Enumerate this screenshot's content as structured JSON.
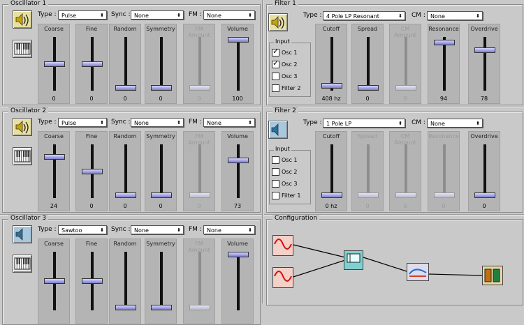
{
  "oscillators": [
    {
      "title": "Oscillator 1",
      "type": "Pulse",
      "sync": "None",
      "fm": "None",
      "icon": "speaker-on-icon",
      "sliders": [
        {
          "name": "Coarse",
          "value": "0",
          "level": 0.5,
          "dim": false
        },
        {
          "name": "Fine",
          "value": "0",
          "level": 0.5,
          "dim": false
        },
        {
          "name": "Random",
          "value": "0",
          "level": 0,
          "dim": false
        },
        {
          "name": "Symmetry",
          "value": "0",
          "level": 0,
          "dim": false
        },
        {
          "name": "FM Amount",
          "value": "0",
          "level": 0,
          "dim": true
        },
        {
          "name": "Volume",
          "value": "100",
          "level": 1,
          "dim": false
        }
      ]
    },
    {
      "title": "Oscillator 2",
      "type": "Pulse",
      "sync": "None",
      "fm": "None",
      "icon": "speaker-on-icon",
      "sliders": [
        {
          "name": "Coarse",
          "value": "24",
          "level": 0.8,
          "dim": false
        },
        {
          "name": "Fine",
          "value": "0",
          "level": 0.5,
          "dim": false
        },
        {
          "name": "Random",
          "value": "0",
          "level": 0,
          "dim": false
        },
        {
          "name": "Symmetry",
          "value": "0",
          "level": 0,
          "dim": false
        },
        {
          "name": "FM Amount",
          "value": "0",
          "level": 0,
          "dim": true
        },
        {
          "name": "Volume",
          "value": "73",
          "level": 0.73,
          "dim": false
        }
      ]
    },
    {
      "title": "Oscillator 3",
      "type": "Sawtoo",
      "sync": "None",
      "fm": "None",
      "icon": "speaker-off-icon",
      "sliders": [
        {
          "name": "Coarse",
          "value": "",
          "level": 0.5,
          "dim": false
        },
        {
          "name": "Fine",
          "value": "",
          "level": 0.5,
          "dim": false
        },
        {
          "name": "Random",
          "value": "",
          "level": 0,
          "dim": false
        },
        {
          "name": "Symmetry",
          "value": "",
          "level": 0,
          "dim": false
        },
        {
          "name": "FM Amount",
          "value": "",
          "level": 0,
          "dim": true
        },
        {
          "name": "Volume",
          "value": "",
          "level": 1,
          "dim": false
        }
      ]
    }
  ],
  "osc_labels": {
    "type": "Type :",
    "sync": "Sync :",
    "fm": "FM :"
  },
  "filters": [
    {
      "title": "Filter 1",
      "type": "4 Pole LP Resonant",
      "cm": "None",
      "icon": "speaker-on-icon",
      "input_title": "Input",
      "inputs": [
        {
          "label": "Osc 1",
          "checked": true
        },
        {
          "label": "Osc 2",
          "checked": true
        },
        {
          "label": "Osc 3",
          "checked": false
        },
        {
          "label": "Filter 2",
          "checked": false
        }
      ],
      "sliders": [
        {
          "name": "Cutoff",
          "value": "408 hz",
          "level": 0.05,
          "dim": false
        },
        {
          "name": "Spread",
          "value": "0",
          "level": 0,
          "dim": false
        },
        {
          "name": "CM Amount",
          "value": "0",
          "level": 0,
          "dim": true
        },
        {
          "name": "Resonance",
          "value": "94",
          "level": 0.94,
          "dim": false
        },
        {
          "name": "Overdrive",
          "value": "78",
          "level": 0.78,
          "dim": false
        }
      ]
    },
    {
      "title": "Filter 2",
      "type": "1 Pole LP",
      "cm": "None",
      "icon": "speaker-off-icon",
      "input_title": "Input",
      "inputs": [
        {
          "label": "Osc 1",
          "checked": false
        },
        {
          "label": "Osc 2",
          "checked": false
        },
        {
          "label": "Osc 3",
          "checked": false
        },
        {
          "label": "Filter 1",
          "checked": false
        }
      ],
      "sliders": [
        {
          "name": "Cutoff",
          "value": "0 hz",
          "level": 0,
          "dim": false
        },
        {
          "name": "Spread",
          "value": "0",
          "level": 0,
          "dim": true
        },
        {
          "name": "CM Amount",
          "value": "0",
          "level": 0,
          "dim": true
        },
        {
          "name": "Resonance",
          "value": "0",
          "level": 0,
          "dim": true
        },
        {
          "name": "Overdrive",
          "value": "0",
          "level": 0,
          "dim": false
        }
      ]
    }
  ],
  "filter_labels": {
    "type": "Type :",
    "cm": "CM :"
  },
  "configuration": {
    "title": "Configuration"
  },
  "colors": {
    "thumb": "#8c8cd8",
    "track": "#111111",
    "panel": "#c9c9c9"
  }
}
